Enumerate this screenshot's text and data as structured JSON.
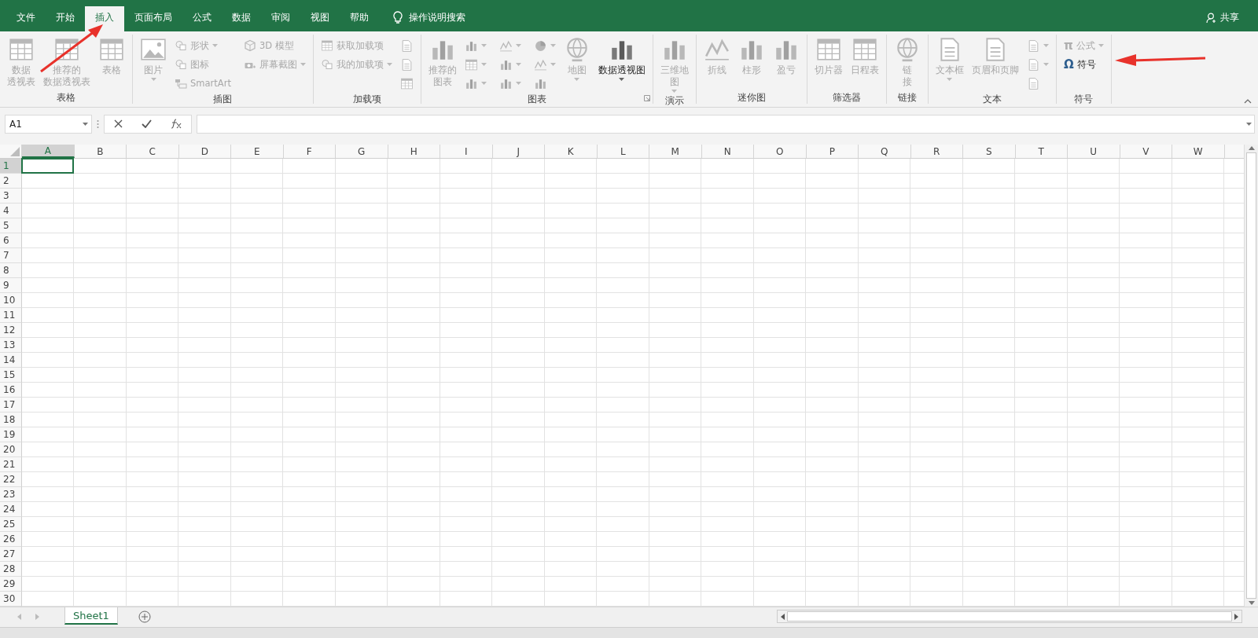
{
  "menu_tabs": [
    {
      "label": "文件",
      "selected": false
    },
    {
      "label": "开始",
      "selected": false
    },
    {
      "label": "插入",
      "selected": true
    },
    {
      "label": "页面布局",
      "selected": false
    },
    {
      "label": "公式",
      "selected": false
    },
    {
      "label": "数据",
      "selected": false
    },
    {
      "label": "审阅",
      "selected": false
    },
    {
      "label": "视图",
      "selected": false
    },
    {
      "label": "帮助",
      "selected": false
    }
  ],
  "tell_me": "操作说明搜索",
  "share": "共享",
  "ribbon_groups": [
    {
      "label": "表格",
      "launcher": false,
      "items": [
        {
          "kind": "large",
          "label": "数据透视表",
          "disabled": true
        },
        {
          "kind": "large",
          "label": "推荐的数据透视表",
          "disabled": true
        },
        {
          "kind": "large",
          "label": "表格",
          "disabled": true
        }
      ]
    },
    {
      "label": "插图",
      "launcher": false,
      "items": [
        {
          "kind": "large",
          "label": "图片",
          "disabled": true,
          "dropdown": true
        },
        {
          "kind": "small",
          "label": "形状",
          "disabled": true,
          "dropdown": true
        },
        {
          "kind": "small",
          "label": "图标",
          "disabled": true
        },
        {
          "kind": "small",
          "label": "SmartArt",
          "disabled": true
        },
        {
          "kind": "small",
          "label": "3D 模型",
          "disabled": true
        },
        {
          "kind": "small",
          "label": "屏幕截图",
          "disabled": true,
          "dropdown": true
        }
      ]
    },
    {
      "label": "加载项",
      "launcher": false,
      "items": [
        {
          "kind": "small",
          "label": "获取加载项",
          "disabled": true
        },
        {
          "kind": "small",
          "label": "我的加载项",
          "disabled": true,
          "dropdown": true
        },
        {
          "kind": "icon",
          "disabled": true
        },
        {
          "kind": "icon",
          "disabled": true
        },
        {
          "kind": "icon",
          "disabled": true
        }
      ]
    },
    {
      "label": "图表",
      "launcher": true,
      "items": [
        {
          "kind": "large",
          "label": "推荐的图表",
          "disabled": true
        },
        {
          "kind": "icon",
          "disabled": true,
          "dropdown": true
        },
        {
          "kind": "icon",
          "disabled": true,
          "dropdown": true
        },
        {
          "kind": "icon",
          "disabled": true,
          "dropdown": true
        },
        {
          "kind": "icon",
          "disabled": true,
          "dropdown": true
        },
        {
          "kind": "icon",
          "disabled": true,
          "dropdown": true
        },
        {
          "kind": "icon",
          "disabled": true,
          "dropdown": true
        },
        {
          "kind": "icon",
          "disabled": true,
          "dropdown": true
        },
        {
          "kind": "icon",
          "disabled": true,
          "dropdown": true
        },
        {
          "kind": "icon",
          "disabled": true,
          "dropdown": false
        },
        {
          "kind": "large",
          "label": "地图",
          "disabled": true,
          "dropdown": true
        },
        {
          "kind": "large",
          "label": "数据透视图",
          "disabled": false,
          "dropdown": true
        }
      ]
    },
    {
      "label": "演示",
      "launcher": false,
      "items": [
        {
          "kind": "large",
          "label": "三维地图",
          "disabled": true,
          "dropdown": true
        }
      ]
    },
    {
      "label": "迷你图",
      "launcher": false,
      "items": [
        {
          "kind": "large",
          "label": "折线",
          "disabled": true
        },
        {
          "kind": "large",
          "label": "柱形",
          "disabled": true
        },
        {
          "kind": "large",
          "label": "盈亏",
          "disabled": true
        }
      ]
    },
    {
      "label": "筛选器",
      "launcher": false,
      "items": [
        {
          "kind": "large",
          "label": "切片器",
          "disabled": true
        },
        {
          "kind": "large",
          "label": "日程表",
          "disabled": true
        }
      ]
    },
    {
      "label": "链接",
      "launcher": false,
      "items": [
        {
          "kind": "large",
          "label": "链接",
          "disabled": true
        }
      ]
    },
    {
      "label": "文本",
      "launcher": false,
      "items": [
        {
          "kind": "large",
          "label": "文本框",
          "disabled": true,
          "dropdown": true
        },
        {
          "kind": "large",
          "label": "页眉和页脚",
          "disabled": true
        },
        {
          "kind": "icon",
          "disabled": true,
          "dropdown": true
        },
        {
          "kind": "icon",
          "disabled": true,
          "dropdown": true
        },
        {
          "kind": "icon",
          "disabled": true
        }
      ]
    },
    {
      "label": "符号",
      "launcher": false,
      "items": [
        {
          "kind": "small",
          "symbol": "π",
          "label": "公式",
          "disabled": true,
          "dropdown": true
        },
        {
          "kind": "small",
          "symbol": "Ω",
          "label": "符号",
          "disabled": false
        }
      ]
    }
  ],
  "name_box": "A1",
  "columns": [
    {
      "label": "A",
      "selected": true
    },
    {
      "label": "B",
      "selected": false
    },
    {
      "label": "C",
      "selected": false
    },
    {
      "label": "D",
      "selected": false
    },
    {
      "label": "E",
      "selected": false
    },
    {
      "label": "F",
      "selected": false
    },
    {
      "label": "G",
      "selected": false
    },
    {
      "label": "H",
      "selected": false
    },
    {
      "label": "I",
      "selected": false
    },
    {
      "label": "J",
      "selected": false
    },
    {
      "label": "K",
      "selected": false
    },
    {
      "label": "L",
      "selected": false
    },
    {
      "label": "M",
      "selected": false
    },
    {
      "label": "N",
      "selected": false
    },
    {
      "label": "O",
      "selected": false
    },
    {
      "label": "P",
      "selected": false
    },
    {
      "label": "Q",
      "selected": false
    },
    {
      "label": "R",
      "selected": false
    },
    {
      "label": "S",
      "selected": false
    },
    {
      "label": "T",
      "selected": false
    },
    {
      "label": "U",
      "selected": false
    },
    {
      "label": "V",
      "selected": false
    },
    {
      "label": "W",
      "selected": false
    }
  ],
  "rows": [
    {
      "label": "1",
      "selected": true
    },
    {
      "label": "2",
      "selected": false
    },
    {
      "label": "3",
      "selected": false
    },
    {
      "label": "4",
      "selected": false
    },
    {
      "label": "5",
      "selected": false
    },
    {
      "label": "6",
      "selected": false
    },
    {
      "label": "7",
      "selected": false
    },
    {
      "label": "8",
      "selected": false
    },
    {
      "label": "9",
      "selected": false
    },
    {
      "label": "10",
      "selected": false
    },
    {
      "label": "11",
      "selected": false
    },
    {
      "label": "12",
      "selected": false
    },
    {
      "label": "13",
      "selected": false
    },
    {
      "label": "14",
      "selected": false
    },
    {
      "label": "15",
      "selected": false
    },
    {
      "label": "16",
      "selected": false
    },
    {
      "label": "17",
      "selected": false
    },
    {
      "label": "18",
      "selected": false
    },
    {
      "label": "19",
      "selected": false
    },
    {
      "label": "20",
      "selected": false
    },
    {
      "label": "21",
      "selected": false
    },
    {
      "label": "22",
      "selected": false
    },
    {
      "label": "23",
      "selected": false
    },
    {
      "label": "24",
      "selected": false
    },
    {
      "label": "25",
      "selected": false
    },
    {
      "label": "26",
      "selected": false
    },
    {
      "label": "27",
      "selected": false
    },
    {
      "label": "28",
      "selected": false
    },
    {
      "label": "29",
      "selected": false
    },
    {
      "label": "30",
      "selected": false
    }
  ],
  "sheet_tabs": [
    {
      "label": "Sheet1",
      "selected": true
    }
  ]
}
